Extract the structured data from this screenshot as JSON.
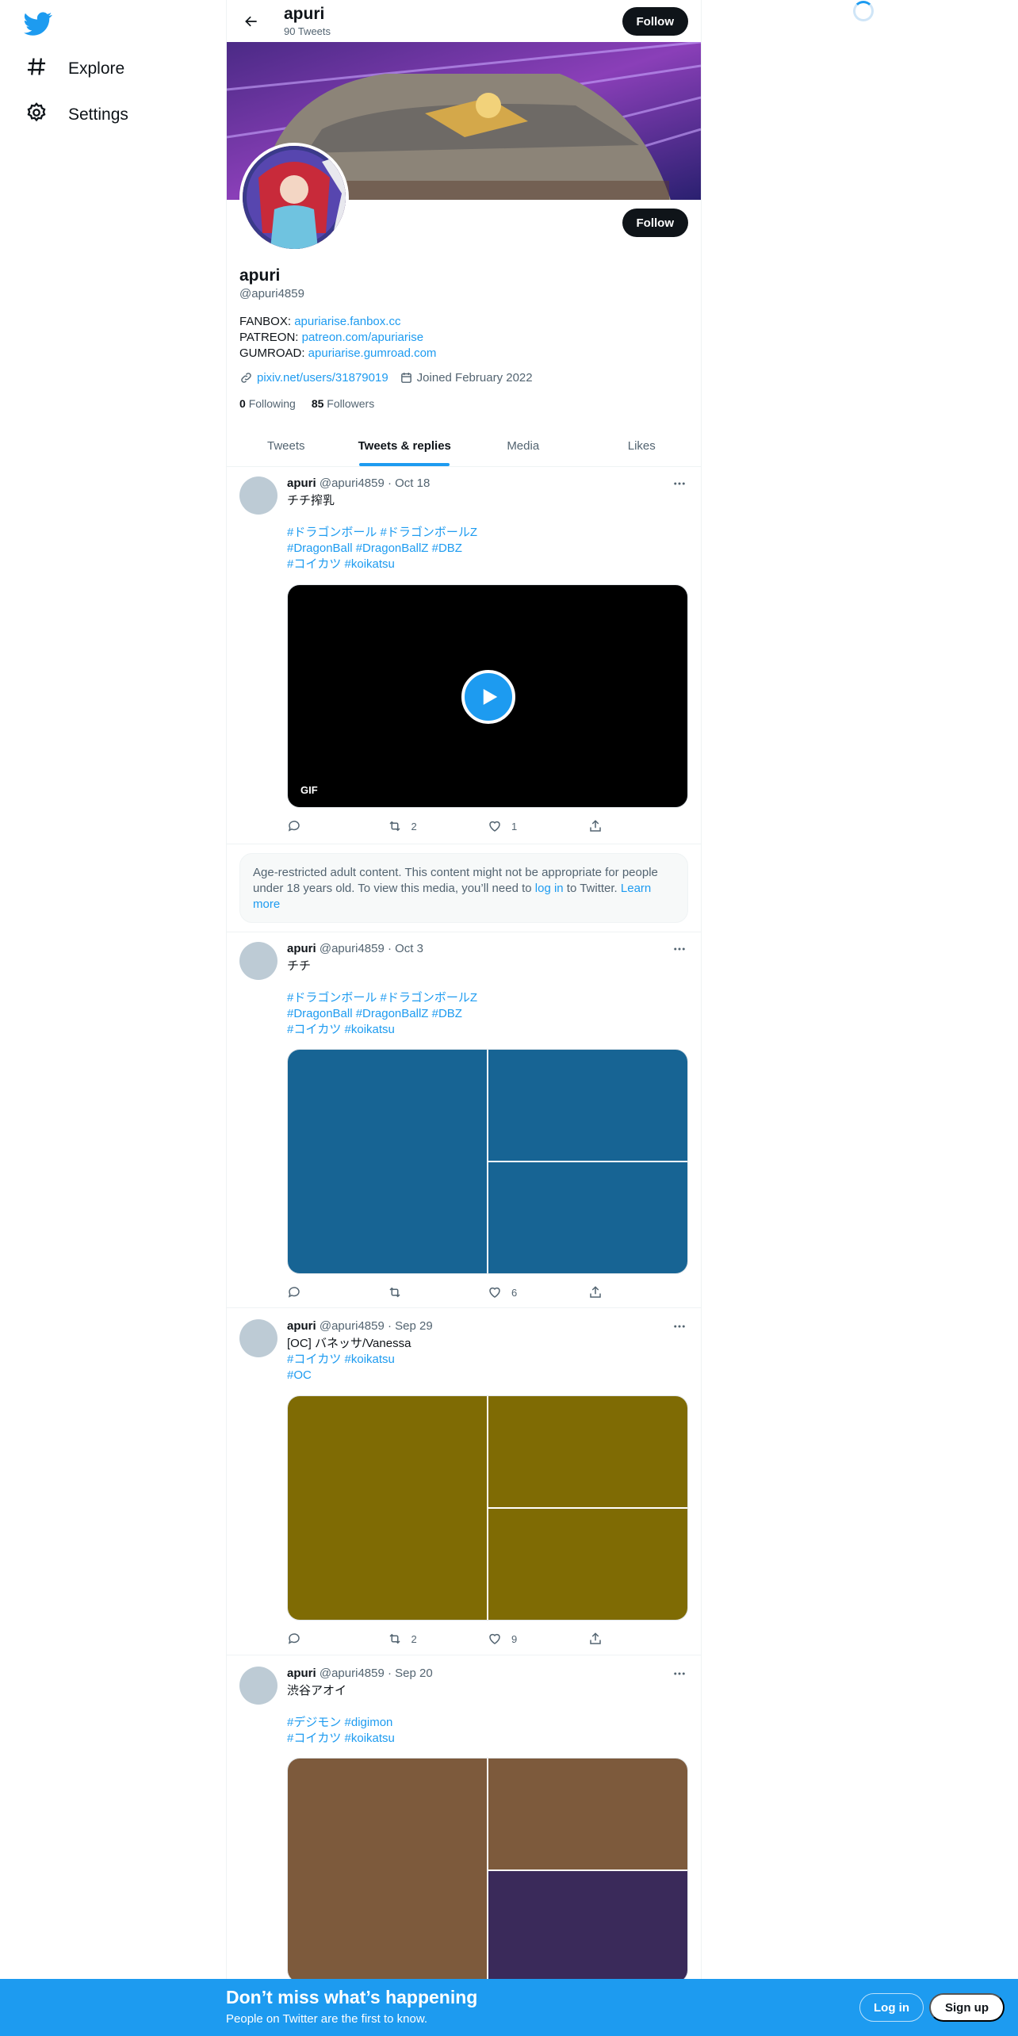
{
  "nav": {
    "items": [
      {
        "label": "Explore",
        "icon": "hashtag-icon"
      },
      {
        "label": "Settings",
        "icon": "gear-icon"
      }
    ]
  },
  "header": {
    "name": "apuri",
    "tweet_count": "90 Tweets",
    "follow_label": "Follow"
  },
  "profile": {
    "name": "apuri",
    "handle": "@apuri4859",
    "follow_label": "Follow",
    "bio": [
      {
        "label": "FANBOX:",
        "link": "apuriarise.fanbox.cc"
      },
      {
        "label": "PATREON:",
        "link": "patreon.com/apuriarise"
      },
      {
        "label": "GUMROAD:",
        "link": "apuriarise.gumroad.com"
      }
    ],
    "website": "pixiv.net/users/31879019",
    "joined": "Joined February 2022",
    "following_count": "0",
    "following_label": "Following",
    "followers_count": "85",
    "followers_label": "Followers"
  },
  "tabs": [
    {
      "label": "Tweets",
      "active": false
    },
    {
      "label": "Tweets & replies",
      "active": true
    },
    {
      "label": "Media",
      "active": false
    },
    {
      "label": "Likes",
      "active": false
    }
  ],
  "tweets": [
    {
      "name": "apuri",
      "meta": "@apuri4859 · Oct 18",
      "text": "チチ搾乳",
      "hashtag_lines": [
        "#ドラゴンボール #ドラゴンボールZ",
        "#DragonBall #DragonBallZ #DBZ",
        "#コイカツ #koikatsu"
      ],
      "media_type": "gif",
      "gif_badge": "GIF",
      "retweets": "2",
      "likes": "1"
    },
    {
      "name": "apuri",
      "meta": "@apuri4859 · Oct 3",
      "text": "チチ",
      "hashtag_lines": [
        "#ドラゴンボール #ドラゴンボールZ",
        "#DragonBall #DragonBallZ #DBZ",
        "#コイカツ #koikatsu"
      ],
      "media_colors": [
        "#176494",
        "#176494",
        "#176494"
      ],
      "retweets": "",
      "likes": "6"
    },
    {
      "name": "apuri",
      "meta": "@apuri4859 · Sep 29",
      "text": "[OC] バネッサ/Vanessa",
      "hashtag_lines": [
        "#コイカツ #koikatsu",
        "#OC"
      ],
      "media_colors": [
        "#7f6b04",
        "#7f6b04",
        "#7f6b04"
      ],
      "retweets": "2",
      "likes": "9"
    },
    {
      "name": "apuri",
      "meta": "@apuri4859 · Sep 20",
      "text": "渋谷アオイ",
      "hashtag_lines": [
        "#デジモン #digimon",
        "#コイカツ #koikatsu"
      ],
      "media_colors": [
        "#7d5a3c",
        "#7d5a3c",
        "#3a2a5a"
      ],
      "retweets": "",
      "likes": ""
    }
  ],
  "age_notice": {
    "text1": "Age-restricted adult content. This content might not be appropriate for people under 18 years old. To view this media, you’ll need to ",
    "login_link": "log in",
    "text2": " to Twitter. ",
    "learn_link": "Learn more"
  },
  "bottom_bar": {
    "title": "Don’t miss what’s happening",
    "subtitle": "People on Twitter are the first to know.",
    "login_label": "Log in",
    "signup_label": "Sign up"
  },
  "colors": {
    "accent": "#1d9bf0",
    "text": "#0f1419",
    "muted": "#536471"
  }
}
